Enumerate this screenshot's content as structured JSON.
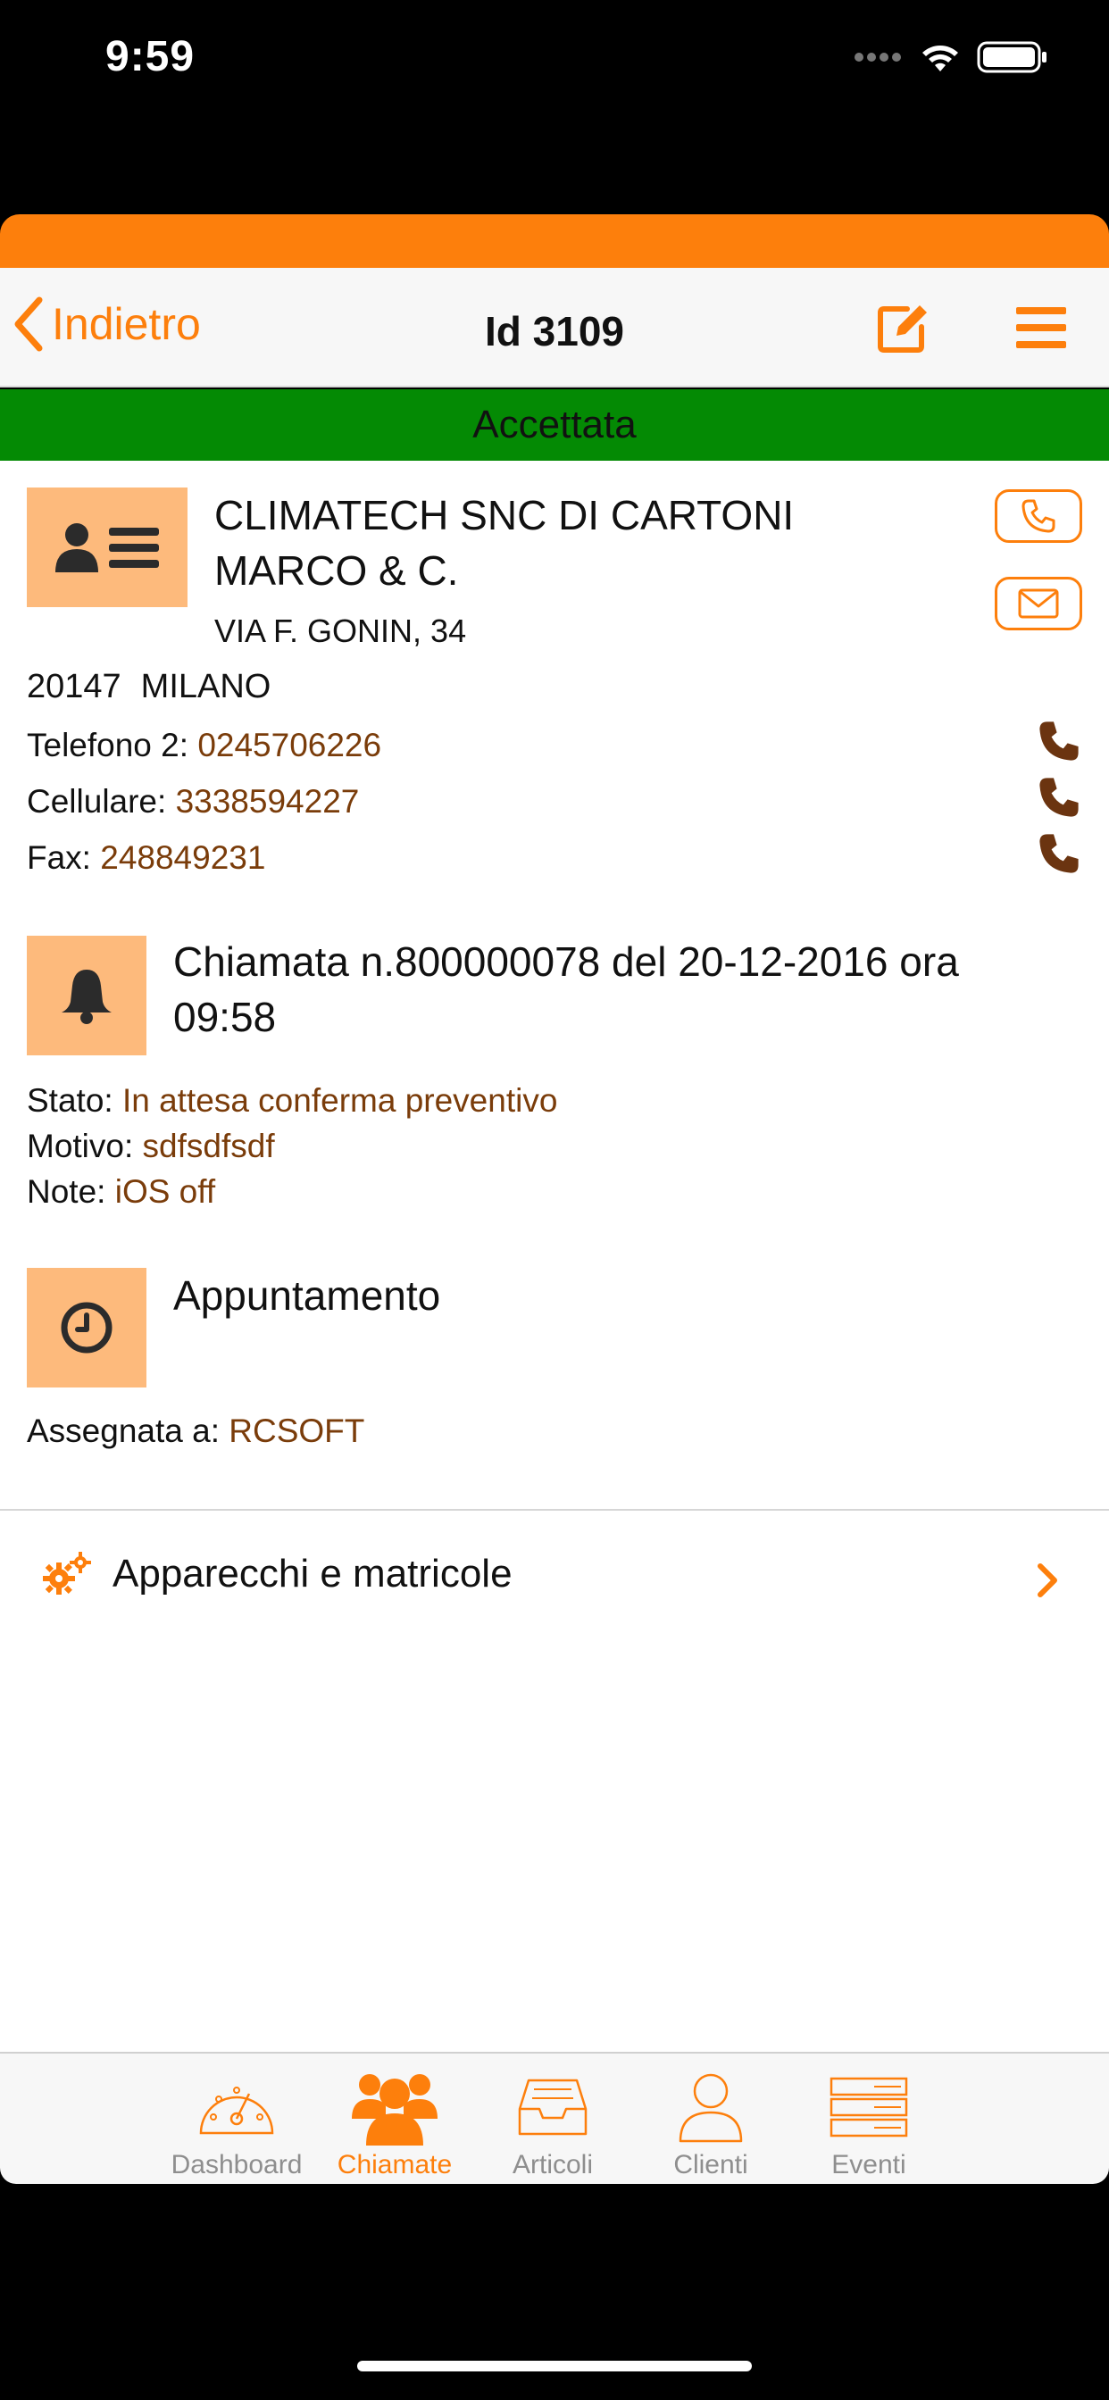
{
  "status_bar": {
    "time": "9:59"
  },
  "navbar": {
    "back_label": "Indietro",
    "title": "Id 3109"
  },
  "status_banner": "Accettata",
  "client": {
    "name": "CLIMATECH SNC DI CARTONI MARCO & C.",
    "address": "VIA F. GONIN, 34",
    "zip": "20147",
    "city": "MILANO",
    "phones": [
      {
        "label": "Telefono 2:",
        "value": "0245706226"
      },
      {
        "label": "Cellulare:",
        "value": "3338594227"
      },
      {
        "label": "Fax:",
        "value": "248849231"
      }
    ]
  },
  "call": {
    "title": "Chiamata n.800000078 del 20-12-2016 ora 09:58",
    "stato_label": "Stato:",
    "stato_value": "In attesa conferma preventivo",
    "motivo_label": "Motivo:",
    "motivo_value": "sdfsdfsdf",
    "note_label": "Note:",
    "note_value": "iOS off"
  },
  "appointment": {
    "title": "Appuntamento",
    "assigned_label": "Assegnata a:",
    "assigned_value": "RCSOFT"
  },
  "equipment": {
    "label": "Apparecchi e matricole"
  },
  "tabbar": {
    "tabs": [
      {
        "label": "Dashboard",
        "icon": "gauge-icon",
        "active": false
      },
      {
        "label": "Chiamate",
        "icon": "people-icon",
        "active": true
      },
      {
        "label": "Articoli",
        "icon": "inbox-tray-icon",
        "active": false
      },
      {
        "label": "Clienti",
        "icon": "person-icon",
        "active": false
      },
      {
        "label": "Eventi",
        "icon": "list-rows-icon",
        "active": false
      }
    ]
  },
  "colors": {
    "accent": "#fd7f0c",
    "banner": "#048a04",
    "tile": "#fdba7c",
    "value_text": "#7a3c0a"
  }
}
